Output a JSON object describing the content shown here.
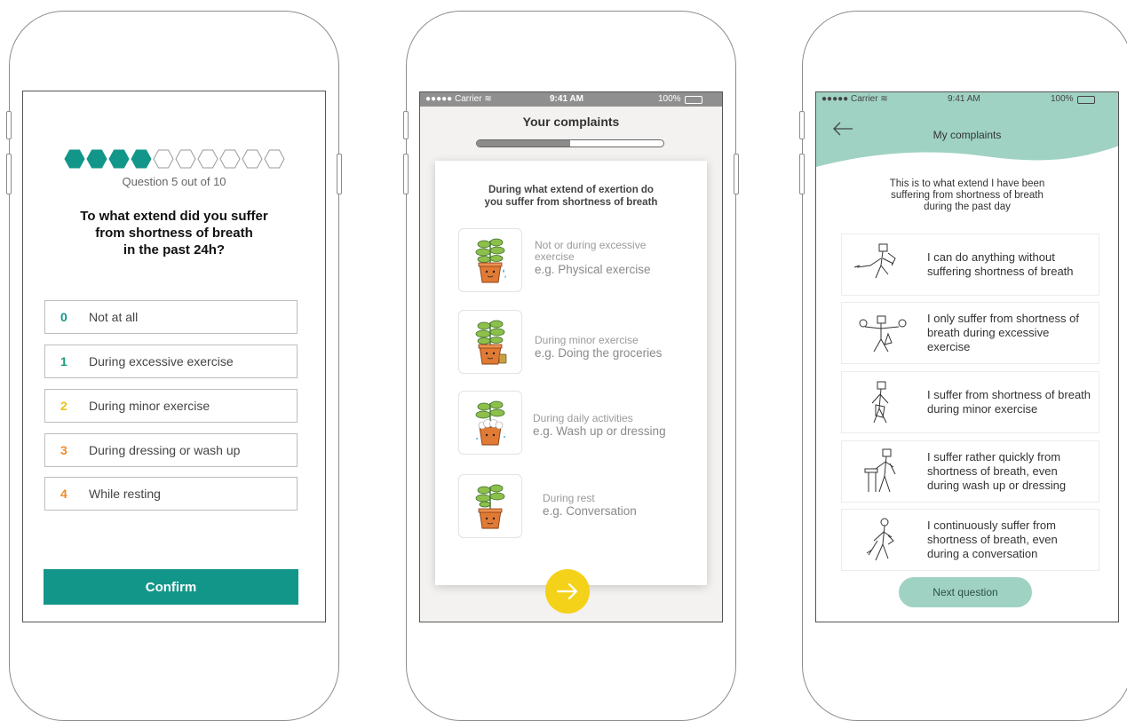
{
  "phone1": {
    "progress": {
      "current": 5,
      "total": 10
    },
    "counter": "Question 5 out of 10",
    "question": "To what extend did you suffer from shortness of breath in the past 24h?",
    "question_lines": [
      "To what extend did you suffer",
      "from shortness of breath",
      "in the past 24h?"
    ],
    "options": [
      {
        "num": "0",
        "label": "Not at all",
        "color": "#13968a"
      },
      {
        "num": "1",
        "label": "During excessive exercise",
        "color": "#1a9c7a"
      },
      {
        "num": "2",
        "label": "During minor exercise",
        "color": "#e9c21c"
      },
      {
        "num": "3",
        "label": "During dressing or wash up",
        "color": "#ef8a2a"
      },
      {
        "num": "4",
        "label": "While resting",
        "color": "#ef8a2a"
      }
    ],
    "confirm_label": "Confirm",
    "colors": {
      "accent": "#13968a"
    }
  },
  "phone2": {
    "status": {
      "carrier": "●●●●● Carrier ≋",
      "time": "9:41 AM",
      "battery": "100%"
    },
    "title": "Your complaints",
    "progress_fraction": 0.5,
    "question_lines": [
      "During what extend of exertion do",
      "you suffer from shortness of breath"
    ],
    "options": [
      {
        "main": [
          "Not or during excessive",
          "exercise"
        ],
        "example": "e.g. Physical exercise",
        "icon": "plant-sweating-icon"
      },
      {
        "main": [
          "During minor exercise"
        ],
        "example": "e.g. Doing the groceries",
        "icon": "plant-walking-icon"
      },
      {
        "main": [
          "During daily activities"
        ],
        "example": "e.g. Wash up or dressing",
        "icon": "plant-washing-icon"
      },
      {
        "main": [
          "During rest"
        ],
        "example": "e.g. Conversation",
        "icon": "plant-resting-icon"
      }
    ],
    "next_icon": "arrow-right-icon",
    "colors": {
      "next": "#f4d21a"
    }
  },
  "phone3": {
    "status": {
      "carrier": "●●●●● Carrier ≋",
      "time": "9:41 AM",
      "battery": "100%"
    },
    "back_icon": "back-arrow-icon",
    "title": "My complaints",
    "intro_lines": [
      "This is to what extend I have been",
      "suffering from shortness of breath",
      "during the past day"
    ],
    "answers": [
      {
        "text": "I can do anything without suffering shortness of breath",
        "icon": "figure-running-icon"
      },
      {
        "text": "I only suffer from shortness of breath during excessive exercise",
        "icon": "figure-juggling-icon"
      },
      {
        "text": "I suffer from shortness of breath during minor exercise",
        "icon": "figure-walking-icon"
      },
      {
        "text": "I suffer rather quickly  from shortness of breath, even during wash up or dressing",
        "icon": "figure-sink-icon"
      },
      {
        "text": "I  continuously suffer from shortness of breath, even during a conversation",
        "icon": "figure-talking-icon"
      }
    ],
    "next_label": "Next question",
    "colors": {
      "header": "#9fd2c3",
      "button": "#9fd2c3"
    }
  }
}
